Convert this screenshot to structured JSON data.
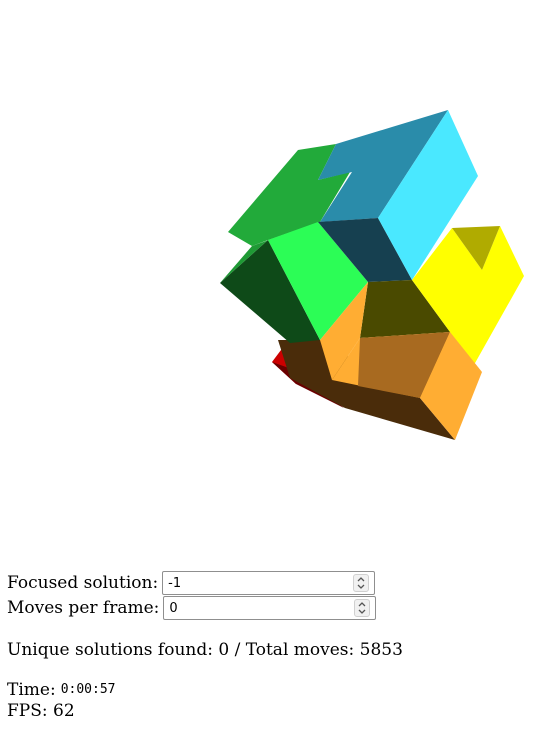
{
  "controls": {
    "focused_solution": {
      "label": "Focused solution:",
      "value": "-1"
    },
    "moves_per_frame": {
      "label": "Moves per frame:",
      "value": "0"
    }
  },
  "stats": {
    "solutions_text": "Unique solutions found: 0 / Total moves: 5853",
    "time_label": "Time:",
    "time_value": "0:00:57",
    "fps_text": "FPS: 62"
  },
  "colors": {
    "cyan": "#4ae8ff",
    "teal": "#2a8caa",
    "dark_teal": "#164050",
    "green": "#22aa3a",
    "bright_green": "#2cfd56",
    "dark_green": "#0e4a18",
    "yellow": "#ffff00",
    "olive": "#b0ab00",
    "orange": "#ffad33",
    "brown": "#a86a20",
    "dark_brown": "#4a2c0a",
    "red": "#cc0000",
    "dark_red": "#6a0000"
  }
}
